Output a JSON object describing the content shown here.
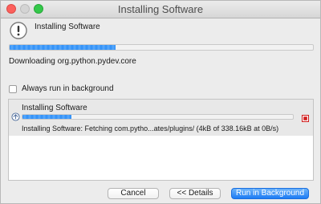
{
  "window": {
    "title": "Installing Software"
  },
  "header": {
    "heading": "Installing Software",
    "icon": "alert-icon"
  },
  "main_progress": {
    "fraction": 0.35,
    "status": "Downloading org.python.pydev.core"
  },
  "option": {
    "label": "Always run in background",
    "checked": false
  },
  "jobs": [
    {
      "name": "Installing Software",
      "fraction": 0.18,
      "detail": "Installing Software: Fetching com.pytho...ates/plugins/ (4kB of 338.16kB at 0B/s)"
    }
  ],
  "buttons": {
    "cancel": "Cancel",
    "details": "<< Details",
    "run_background": "Run in Background"
  },
  "colors": {
    "accent": "#2f8ff7",
    "stop": "#d11d1d"
  }
}
